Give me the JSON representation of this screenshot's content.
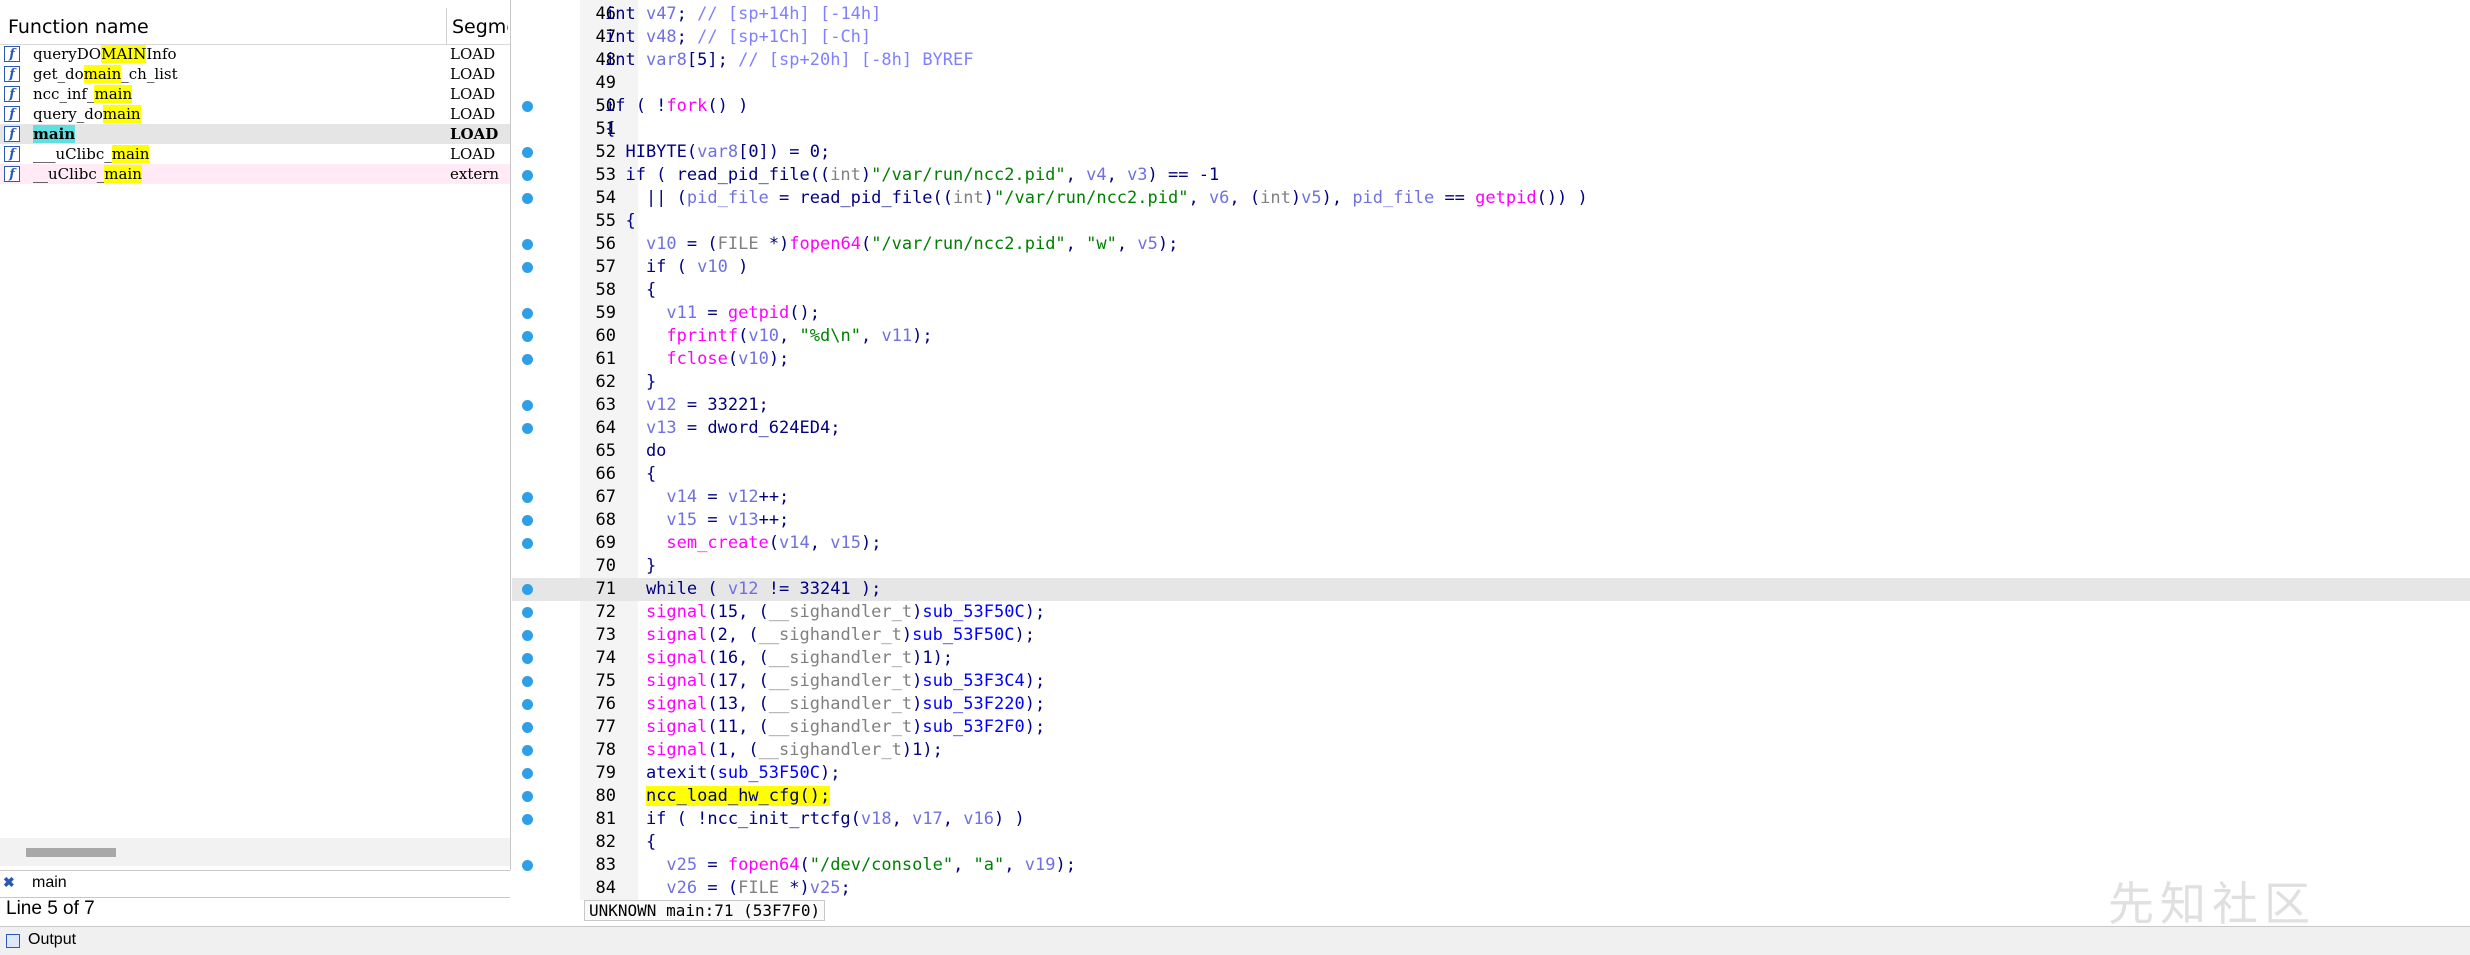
{
  "functions_panel": {
    "col_name": "Function name",
    "col_segment": "Segme",
    "rows": [
      {
        "pre": "queryDO",
        "hl": "MAIN",
        "post": "Info",
        "seg": "LOAD"
      },
      {
        "pre": "get_do",
        "hl": "main",
        "post": "_ch_list",
        "seg": "LOAD"
      },
      {
        "pre": "ncc_inf_",
        "hl": "main",
        "post": "",
        "seg": "LOAD"
      },
      {
        "pre": "query_do",
        "hl": "main",
        "post": "",
        "seg": "LOAD"
      },
      {
        "pre": "",
        "hl": "main",
        "post": "",
        "seg": "LOAD"
      },
      {
        "pre": "___uClibc_",
        "hl": "main",
        "post": "",
        "seg": "LOAD"
      },
      {
        "pre": "__uClibc_",
        "hl": "main",
        "post": "",
        "seg": "extern"
      }
    ],
    "filter_text": "main",
    "line_info": "Line 5 of 7"
  },
  "code": {
    "lines": [
      {
        "n": "46",
        "bp": false,
        "segs": [
          [
            "int ",
            "kw"
          ],
          [
            "v47",
            "var"
          ],
          [
            "; ",
            "kw"
          ],
          [
            "// [sp+14h] [-14h]",
            "cmt"
          ]
        ]
      },
      {
        "n": "47",
        "bp": false,
        "segs": [
          [
            "int ",
            "kw"
          ],
          [
            "v48",
            "var"
          ],
          [
            "; ",
            "kw"
          ],
          [
            "// [sp+1Ch] [-Ch]",
            "cmt"
          ]
        ]
      },
      {
        "n": "48",
        "bp": false,
        "segs": [
          [
            "int ",
            "kw"
          ],
          [
            "var8",
            "var"
          ],
          [
            "[5]; ",
            "kw"
          ],
          [
            "// [sp+20h] [-8h] BYREF",
            "cmt"
          ]
        ]
      },
      {
        "n": "49",
        "bp": false,
        "segs": []
      },
      {
        "n": "50",
        "bp": true,
        "segs": [
          [
            "if ( !",
            "kw"
          ],
          [
            "fork",
            "fn"
          ],
          [
            "() )",
            "kw"
          ]
        ]
      },
      {
        "n": "51",
        "bp": false,
        "segs": [
          [
            "{",
            "kw"
          ]
        ]
      },
      {
        "n": "52",
        "bp": true,
        "segs": [
          [
            "  HIBYTE(",
            "kw"
          ],
          [
            "var8",
            "var"
          ],
          [
            "[0]) = 0;",
            "kw"
          ]
        ]
      },
      {
        "n": "53",
        "bp": true,
        "segs": [
          [
            "  if ( read_pid_file((",
            "kw"
          ],
          [
            "int",
            "type"
          ],
          [
            ")",
            "kw"
          ],
          [
            "\"/var/run/ncc2.pid\"",
            "str"
          ],
          [
            ", ",
            "kw"
          ],
          [
            "v4",
            "var"
          ],
          [
            ", ",
            "kw"
          ],
          [
            "v3",
            "var"
          ],
          [
            ") == -1",
            "kw"
          ]
        ]
      },
      {
        "n": "54",
        "bp": true,
        "segs": [
          [
            "    || (",
            "kw"
          ],
          [
            "pid_file",
            "var"
          ],
          [
            " = read_pid_file((",
            "kw"
          ],
          [
            "int",
            "type"
          ],
          [
            ")",
            "kw"
          ],
          [
            "\"/var/run/ncc2.pid\"",
            "str"
          ],
          [
            ", ",
            "kw"
          ],
          [
            "v6",
            "var"
          ],
          [
            ", (",
            "kw"
          ],
          [
            "int",
            "type"
          ],
          [
            ")",
            "kw"
          ],
          [
            "v5",
            "var"
          ],
          [
            "), ",
            "kw"
          ],
          [
            "pid_file",
            "var"
          ],
          [
            " == ",
            "kw"
          ],
          [
            "getpid",
            "fn"
          ],
          [
            "()) )",
            "kw"
          ]
        ]
      },
      {
        "n": "55",
        "bp": false,
        "segs": [
          [
            "  {",
            "kw"
          ]
        ]
      },
      {
        "n": "56",
        "bp": true,
        "segs": [
          [
            "    ",
            "kw"
          ],
          [
            "v10",
            "var"
          ],
          [
            " = (",
            "kw"
          ],
          [
            "FILE",
            "type"
          ],
          [
            " *)",
            "kw"
          ],
          [
            "fopen64",
            "fn"
          ],
          [
            "(",
            "kw"
          ],
          [
            "\"/var/run/ncc2.pid\"",
            "str"
          ],
          [
            ", ",
            "kw"
          ],
          [
            "\"w\"",
            "str"
          ],
          [
            ", ",
            "kw"
          ],
          [
            "v5",
            "var"
          ],
          [
            ");",
            "kw"
          ]
        ]
      },
      {
        "n": "57",
        "bp": true,
        "segs": [
          [
            "    if ( ",
            "kw"
          ],
          [
            "v10",
            "var"
          ],
          [
            " )",
            "kw"
          ]
        ]
      },
      {
        "n": "58",
        "bp": false,
        "segs": [
          [
            "    {",
            "kw"
          ]
        ]
      },
      {
        "n": "59",
        "bp": true,
        "segs": [
          [
            "      ",
            "kw"
          ],
          [
            "v11",
            "var"
          ],
          [
            " = ",
            "kw"
          ],
          [
            "getpid",
            "fn"
          ],
          [
            "();",
            "kw"
          ]
        ]
      },
      {
        "n": "60",
        "bp": true,
        "segs": [
          [
            "      ",
            "kw"
          ],
          [
            "fprintf",
            "fn"
          ],
          [
            "(",
            "kw"
          ],
          [
            "v10",
            "var"
          ],
          [
            ", ",
            "kw"
          ],
          [
            "\"%d\\n\"",
            "str"
          ],
          [
            ", ",
            "kw"
          ],
          [
            "v11",
            "var"
          ],
          [
            ");",
            "kw"
          ]
        ]
      },
      {
        "n": "61",
        "bp": true,
        "segs": [
          [
            "      ",
            "kw"
          ],
          [
            "fclose",
            "fn"
          ],
          [
            "(",
            "kw"
          ],
          [
            "v10",
            "var"
          ],
          [
            ");",
            "kw"
          ]
        ]
      },
      {
        "n": "62",
        "bp": false,
        "segs": [
          [
            "    }",
            "kw"
          ]
        ]
      },
      {
        "n": "63",
        "bp": true,
        "segs": [
          [
            "    ",
            "kw"
          ],
          [
            "v12",
            "var"
          ],
          [
            " = 33221;",
            "kw"
          ]
        ]
      },
      {
        "n": "64",
        "bp": true,
        "segs": [
          [
            "    ",
            "kw"
          ],
          [
            "v13",
            "var"
          ],
          [
            " = dword_624ED4;",
            "kw"
          ]
        ]
      },
      {
        "n": "65",
        "bp": false,
        "segs": [
          [
            "    do",
            "kw"
          ]
        ]
      },
      {
        "n": "66",
        "bp": false,
        "segs": [
          [
            "    {",
            "kw"
          ]
        ]
      },
      {
        "n": "67",
        "bp": true,
        "segs": [
          [
            "      ",
            "kw"
          ],
          [
            "v14",
            "var"
          ],
          [
            " = ",
            "kw"
          ],
          [
            "v12",
            "var"
          ],
          [
            "++;",
            "kw"
          ]
        ]
      },
      {
        "n": "68",
        "bp": true,
        "segs": [
          [
            "      ",
            "kw"
          ],
          [
            "v15",
            "var"
          ],
          [
            " = ",
            "kw"
          ],
          [
            "v13",
            "var"
          ],
          [
            "++;",
            "kw"
          ]
        ]
      },
      {
        "n": "69",
        "bp": true,
        "segs": [
          [
            "      ",
            "kw"
          ],
          [
            "sem_create",
            "fn"
          ],
          [
            "(",
            "kw"
          ],
          [
            "v14",
            "var"
          ],
          [
            ", ",
            "kw"
          ],
          [
            "v15",
            "var"
          ],
          [
            ");",
            "kw"
          ]
        ]
      },
      {
        "n": "70",
        "bp": false,
        "segs": [
          [
            "    }",
            "kw"
          ]
        ]
      },
      {
        "n": "71",
        "bp": true,
        "current": true,
        "segs": [
          [
            "    while ( ",
            "kw"
          ],
          [
            "v12",
            "var"
          ],
          [
            " != 33241 );",
            "kw"
          ]
        ]
      },
      {
        "n": "72",
        "bp": true,
        "segs": [
          [
            "    ",
            "kw"
          ],
          [
            "signal",
            "fn"
          ],
          [
            "(15, (",
            "kw"
          ],
          [
            "__sighandler_t",
            "type"
          ],
          [
            ")",
            "kw"
          ],
          [
            "sub_53F50C",
            "call"
          ],
          [
            ");",
            "kw"
          ]
        ]
      },
      {
        "n": "73",
        "bp": true,
        "segs": [
          [
            "    ",
            "kw"
          ],
          [
            "signal",
            "fn"
          ],
          [
            "(2, (",
            "kw"
          ],
          [
            "__sighandler_t",
            "type"
          ],
          [
            ")",
            "kw"
          ],
          [
            "sub_53F50C",
            "call"
          ],
          [
            ");",
            "kw"
          ]
        ]
      },
      {
        "n": "74",
        "bp": true,
        "segs": [
          [
            "    ",
            "kw"
          ],
          [
            "signal",
            "fn"
          ],
          [
            "(16, (",
            "kw"
          ],
          [
            "__sighandler_t",
            "type"
          ],
          [
            ")1);",
            "kw"
          ]
        ]
      },
      {
        "n": "75",
        "bp": true,
        "segs": [
          [
            "    ",
            "kw"
          ],
          [
            "signal",
            "fn"
          ],
          [
            "(17, (",
            "kw"
          ],
          [
            "__sighandler_t",
            "type"
          ],
          [
            ")",
            "kw"
          ],
          [
            "sub_53F3C4",
            "call"
          ],
          [
            ");",
            "kw"
          ]
        ]
      },
      {
        "n": "76",
        "bp": true,
        "segs": [
          [
            "    ",
            "kw"
          ],
          [
            "signal",
            "fn"
          ],
          [
            "(13, (",
            "kw"
          ],
          [
            "__sighandler_t",
            "type"
          ],
          [
            ")",
            "kw"
          ],
          [
            "sub_53F220",
            "call"
          ],
          [
            ");",
            "kw"
          ]
        ]
      },
      {
        "n": "77",
        "bp": true,
        "segs": [
          [
            "    ",
            "kw"
          ],
          [
            "signal",
            "fn"
          ],
          [
            "(11, (",
            "kw"
          ],
          [
            "__sighandler_t",
            "type"
          ],
          [
            ")",
            "kw"
          ],
          [
            "sub_53F2F0",
            "call"
          ],
          [
            ");",
            "kw"
          ]
        ]
      },
      {
        "n": "78",
        "bp": true,
        "segs": [
          [
            "    ",
            "kw"
          ],
          [
            "signal",
            "fn"
          ],
          [
            "(1, (",
            "kw"
          ],
          [
            "__sighandler_t",
            "type"
          ],
          [
            ")1);",
            "kw"
          ]
        ]
      },
      {
        "n": "79",
        "bp": true,
        "segs": [
          [
            "    atexit(",
            "kw"
          ],
          [
            "sub_53F50C",
            "call"
          ],
          [
            ");",
            "kw"
          ]
        ]
      },
      {
        "n": "80",
        "bp": true,
        "segs": [
          [
            "    ",
            "kw"
          ],
          [
            "ncc_load_hw_cfg();",
            "hl"
          ]
        ]
      },
      {
        "n": "81",
        "bp": true,
        "segs": [
          [
            "    if ( !ncc_init_rtcfg(",
            "kw"
          ],
          [
            "v18",
            "var"
          ],
          [
            ", ",
            "kw"
          ],
          [
            "v17",
            "var"
          ],
          [
            ", ",
            "kw"
          ],
          [
            "v16",
            "var"
          ],
          [
            ") )",
            "kw"
          ]
        ]
      },
      {
        "n": "82",
        "bp": false,
        "segs": [
          [
            "    {",
            "kw"
          ]
        ]
      },
      {
        "n": "83",
        "bp": true,
        "segs": [
          [
            "      ",
            "kw"
          ],
          [
            "v25",
            "var"
          ],
          [
            " = ",
            "kw"
          ],
          [
            "fopen64",
            "fn"
          ],
          [
            "(",
            "kw"
          ],
          [
            "\"/dev/console\"",
            "str"
          ],
          [
            ", ",
            "kw"
          ],
          [
            "\"a\"",
            "str"
          ],
          [
            ", ",
            "kw"
          ],
          [
            "v19",
            "var"
          ],
          [
            ");",
            "kw"
          ]
        ]
      },
      {
        "n": "84",
        "bp": false,
        "segs": [
          [
            "      ",
            "kw"
          ],
          [
            "v26",
            "var"
          ],
          [
            " = (",
            "kw"
          ],
          [
            "FILE",
            "type"
          ],
          [
            " *)",
            "kw"
          ],
          [
            "v25",
            "var"
          ],
          [
            ";",
            "kw"
          ]
        ]
      }
    ]
  },
  "status": {
    "text": "UNKNOWN main:71 (53F7F0)"
  },
  "output": {
    "label": "Output"
  },
  "watermark": "先知社区",
  "colors": {
    "breakpoint": "#2fa0e6",
    "highlight": "#ffff00",
    "keyword": "#000080",
    "function": "#ff00ff",
    "variable": "#7070e0",
    "string": "#008000",
    "comment": "#8080ff"
  }
}
